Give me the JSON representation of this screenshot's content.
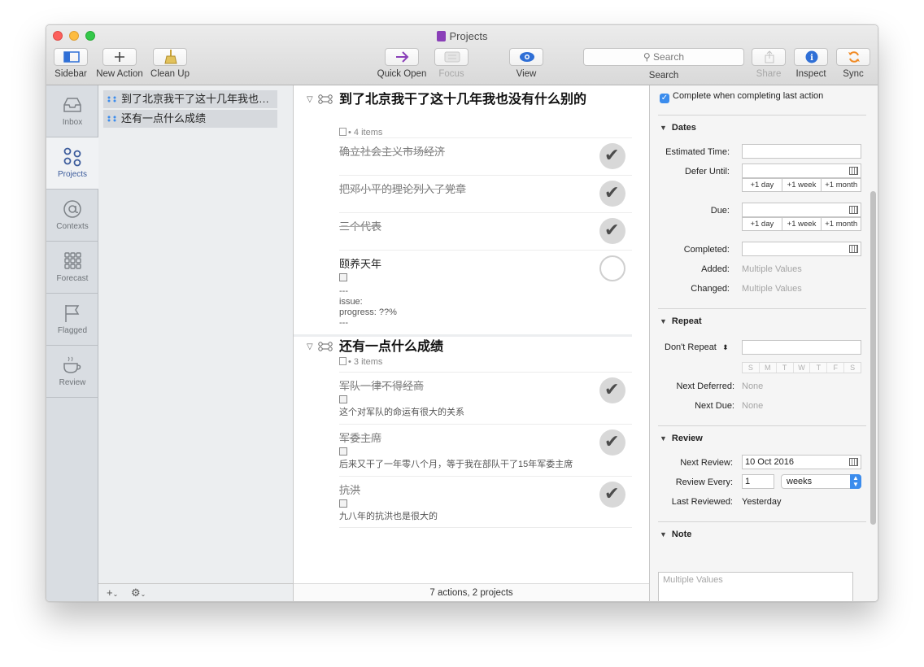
{
  "window": {
    "title": "Projects"
  },
  "toolbar": {
    "sidebar": "Sidebar",
    "new_action": "New Action",
    "clean_up": "Clean Up",
    "quick_open": "Quick Open",
    "focus": "Focus",
    "view": "View",
    "search_placeholder": "Search",
    "search_label": "Search",
    "share": "Share",
    "inspect": "Inspect",
    "sync": "Sync"
  },
  "perspectives": [
    {
      "label": "Inbox",
      "icon": "inbox-icon"
    },
    {
      "label": "Projects",
      "icon": "projects-icon"
    },
    {
      "label": "Contexts",
      "icon": "at-sign-icon"
    },
    {
      "label": "Forecast",
      "icon": "grid-icon"
    },
    {
      "label": "Flagged",
      "icon": "flag-icon"
    },
    {
      "label": "Review",
      "icon": "coffee-cup-icon"
    }
  ],
  "projects": [
    {
      "name": "到了北京我干了这十几年我也…"
    },
    {
      "name": "还有一点什么成绩"
    }
  ],
  "outline": {
    "groups": [
      {
        "title": "到了北京我干了这十几年我也没有什么别的",
        "meta": "• 4 items",
        "actions": [
          {
            "title": "确立社会主义市场经济",
            "note": ""
          },
          {
            "title": "把邓小平的理论列入了党章",
            "note": ""
          },
          {
            "title": "三个代表",
            "note": ""
          },
          {
            "title": "颐养天年",
            "note": "---\nissue:\nprogress: ??%\n---"
          }
        ]
      },
      {
        "title": "还有一点什么成绩",
        "meta": "• 3 items",
        "actions": [
          {
            "title": "军队一律不得经商",
            "note": "这个对军队的命运有很大的关系"
          },
          {
            "title": "军委主席",
            "note": "后来又干了一年零八个月，等于我在部队干了15年军委主席"
          },
          {
            "title": "抗洪",
            "note": "九八年的抗洪也是很大的"
          }
        ]
      }
    ],
    "footer": "7 actions, 2 projects"
  },
  "inspector": {
    "complete_label": "Complete when completing last action",
    "dates": {
      "header": "Dates",
      "estimated_time": "Estimated Time:",
      "defer_until": "Defer Until:",
      "due": "Due:",
      "completed": "Completed:",
      "added": "Added:",
      "added_value": "Multiple Values",
      "changed": "Changed:",
      "changed_value": "Multiple Values",
      "quick": [
        "+1 day",
        "+1 week",
        "+1 month"
      ]
    },
    "repeat": {
      "header": "Repeat",
      "mode": "Don't Repeat",
      "days": [
        "S",
        "M",
        "T",
        "W",
        "T",
        "F",
        "S"
      ],
      "next_deferred": "Next Deferred:",
      "next_deferred_value": "None",
      "next_due": "Next Due:",
      "next_due_value": "None"
    },
    "review": {
      "header": "Review",
      "next_review": "Next Review:",
      "next_review_value": "10 Oct 2016",
      "review_every": "Review Every:",
      "review_every_count": "1",
      "review_every_unit": "weeks",
      "last_reviewed": "Last Reviewed:",
      "last_reviewed_value": "Yesterday"
    },
    "note": {
      "header": "Note",
      "placeholder": "Multiple Values"
    }
  },
  "colors": {
    "accent": "#3b8ced",
    "window_chrome": "#dcdcdc",
    "perspective_active": "#3c5c9c"
  }
}
